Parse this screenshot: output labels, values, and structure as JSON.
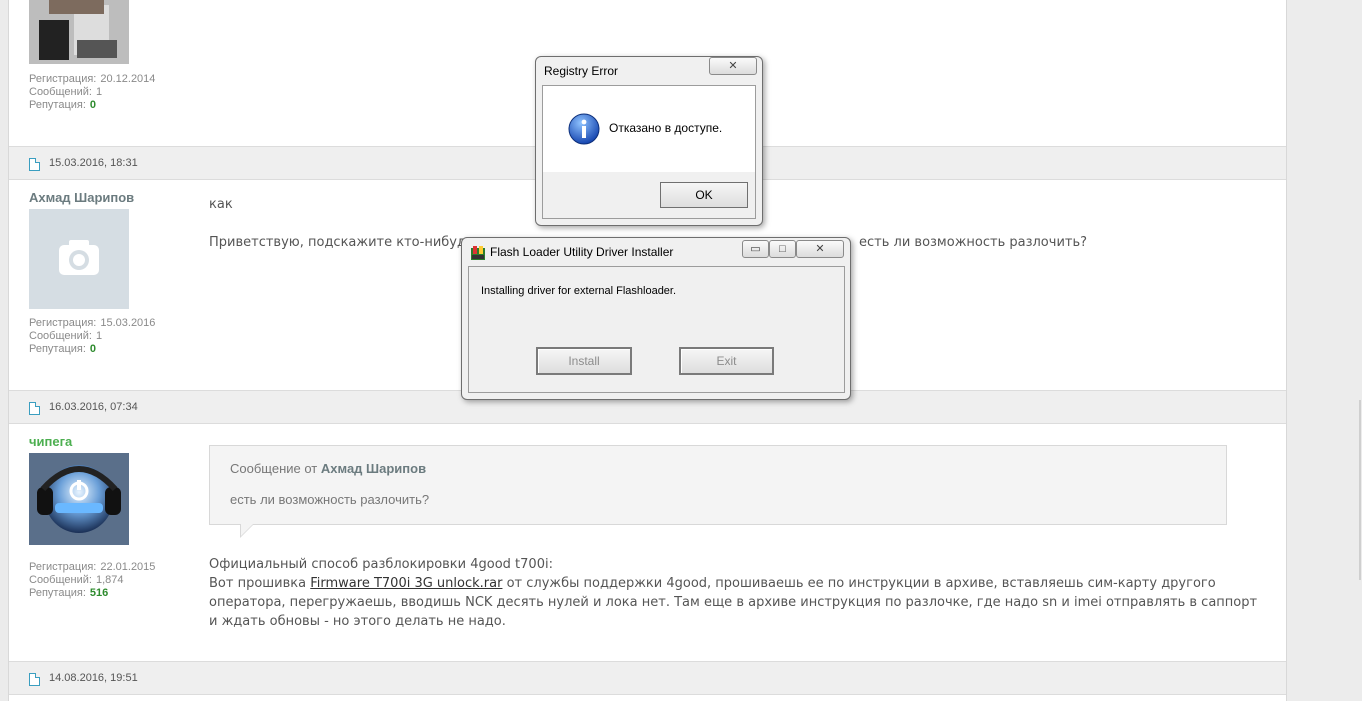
{
  "posts": [
    {
      "meta": {
        "reg_label": "Регистрация:",
        "reg": "20.12.2014",
        "msgs_label": "Сообщений:",
        "msgs": "1",
        "rep_label": "Репутация:",
        "rep": "0"
      }
    },
    {
      "date": "15.03.2016, 18:31",
      "author": "Ахмад Шарипов",
      "meta": {
        "reg_label": "Регистрация:",
        "reg": "15.03.2016",
        "msgs_label": "Сообщений:",
        "msgs": "1",
        "rep_label": "Репутация:",
        "rep": "0"
      },
      "line1": "как",
      "line2a": "Приветствую, подскажите кто-нибуд",
      "line2b": "есть ли возможность разлочить?"
    },
    {
      "date": "16.03.2016, 07:34",
      "author": "чипега",
      "meta": {
        "reg_label": "Регистрация:",
        "reg": "22.01.2015",
        "msgs_label": "Сообщений:",
        "msgs": "1,874",
        "rep_label": "Репутация:",
        "rep": "516"
      },
      "quote_prefix": "Сообщение от",
      "quote_author": "Ахмад Шарипов",
      "quote_text": "есть ли возможность разлочить?",
      "body_line1": "Официальный способ разблокировки 4good t700i:",
      "body_pre": "Вот прошивка",
      "link": "Firmware T700i 3G unlock.rar",
      "body_post": "от службы поддержки 4good, прошиваешь ее по инструкции в архиве, вставляешь сим-карту другого",
      "body_line3": "оператора, перегружаешь, вводишь NCK десять нулей и лока нет. Там еще в архиве инструкция по разлочке, где надо sn и imei отправлять в саппорт",
      "body_line4": "и ждать обновы - но этого делать не надо."
    },
    {
      "date": "14.08.2016, 19:51"
    }
  ],
  "registry_dialog": {
    "title": "Registry Error",
    "message": "Отказано в доступе.",
    "ok": "OK",
    "close": "✕"
  },
  "installer_dialog": {
    "title": "Flash Loader Utility Driver Installer",
    "message": "Installing driver for external Flashloader.",
    "install": "Install",
    "exit": "Exit",
    "minimize": "▭",
    "maximize": "□",
    "close": "✕"
  },
  "colors": {
    "accent_blue": "#3a9ec0",
    "green_user": "#4caf50",
    "reputation": "#2e8b2e"
  }
}
